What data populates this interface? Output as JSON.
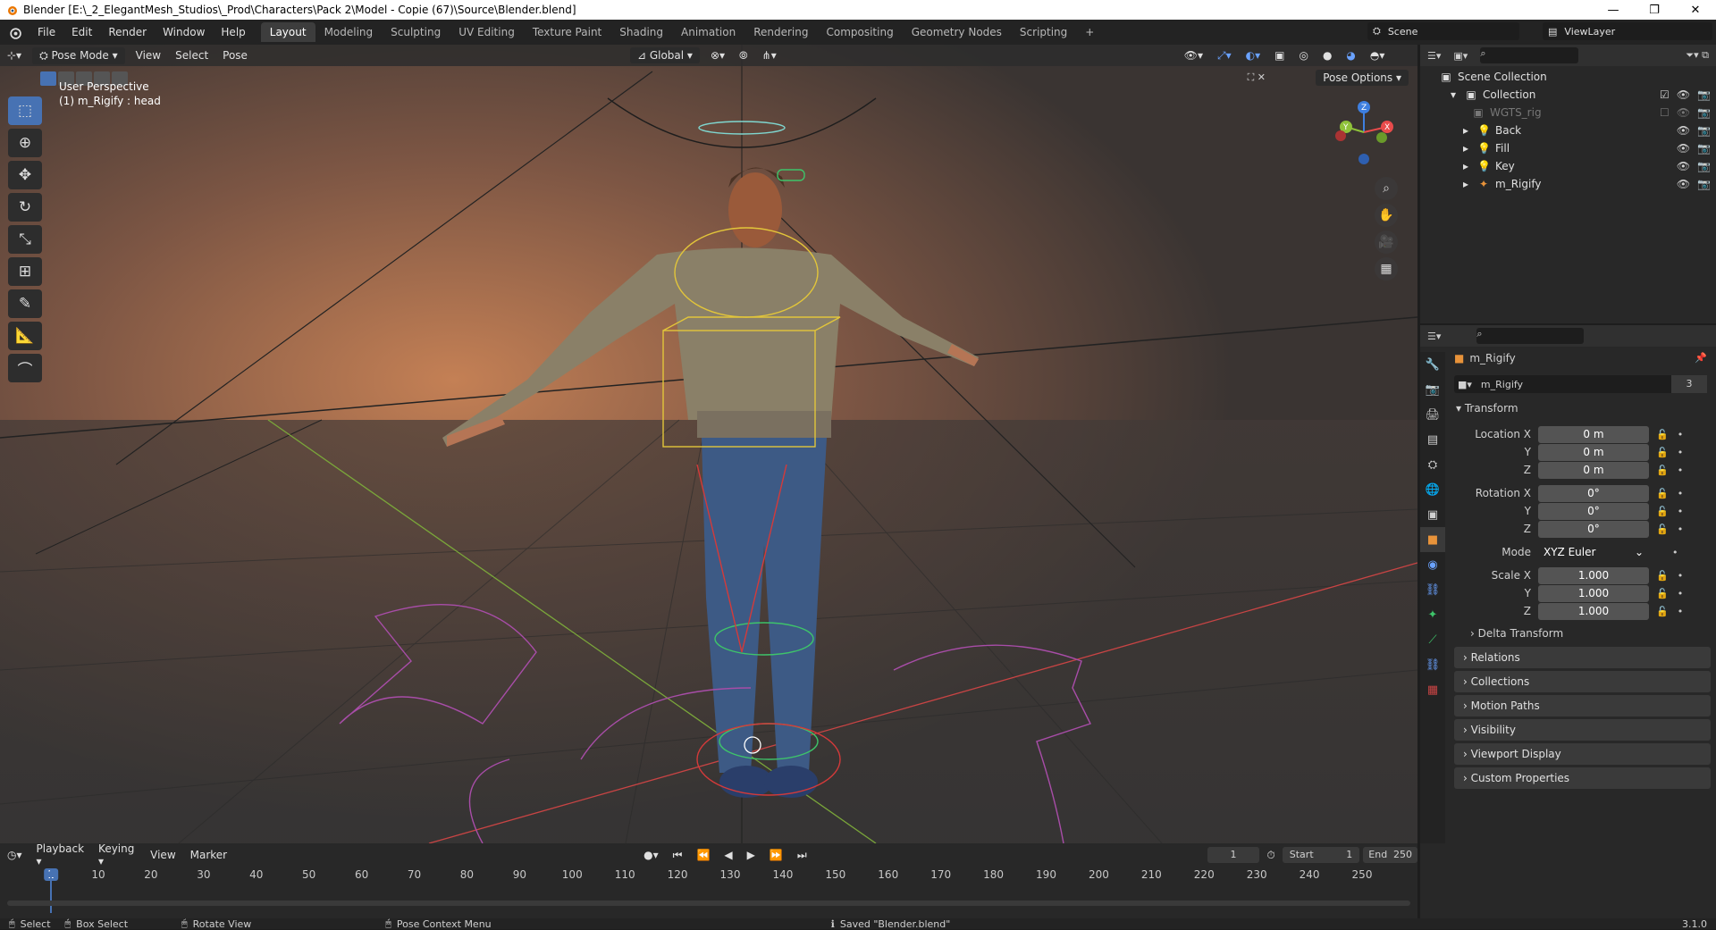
{
  "title": "Blender [E:\\_2_ElegantMesh_Studios\\_Prod\\Characters\\Pack 2\\Model - Copie (67)\\Source\\Blender.blend]",
  "menu": [
    "File",
    "Edit",
    "Render",
    "Window",
    "Help"
  ],
  "workspace_tabs": [
    "Layout",
    "Modeling",
    "Sculpting",
    "UV Editing",
    "Texture Paint",
    "Shading",
    "Animation",
    "Rendering",
    "Compositing",
    "Geometry Nodes",
    "Scripting"
  ],
  "scene": "Scene",
  "view_layer": "ViewLayer",
  "viewport": {
    "mode": "Pose Mode",
    "menus": [
      "View",
      "Select",
      "Pose"
    ],
    "transform_orientation": "Global",
    "pose_options": "Pose Options",
    "perspective": "User Perspective",
    "active": "(1) m_Rigify : head"
  },
  "outliner": {
    "root": "Scene Collection",
    "items": [
      "Collection",
      "WGTS_rig",
      "Back",
      "Fill",
      "Key",
      "m_Rigify"
    ]
  },
  "properties": {
    "object_name": "m_Rigify",
    "datablock": "m_Rigify",
    "users": "3",
    "transform_label": "Transform",
    "location": {
      "label": "Location X",
      "x": "0 m",
      "y": "0 m",
      "z": "0 m"
    },
    "rotation": {
      "label": "Rotation X",
      "x": "0°",
      "y": "0°",
      "z": "0°"
    },
    "mode_label": "Mode",
    "mode": "XYZ Euler",
    "scale": {
      "label": "Scale X",
      "x": "1.000",
      "y": "1.000",
      "z": "1.000"
    },
    "axis_y": "Y",
    "axis_z": "Z",
    "delta": "Delta Transform",
    "panels": [
      "Relations",
      "Collections",
      "Motion Paths",
      "Visibility",
      "Viewport Display",
      "Custom Properties"
    ]
  },
  "timeline": {
    "menus": [
      "Playback",
      "Keying",
      "View",
      "Marker"
    ],
    "current_frame": "1",
    "start_label": "Start",
    "start": "1",
    "end_label": "End",
    "end": "250",
    "ticks": [
      "1",
      "10",
      "20",
      "30",
      "40",
      "50",
      "60",
      "70",
      "80",
      "90",
      "100",
      "110",
      "120",
      "130",
      "140",
      "150",
      "160",
      "170",
      "180",
      "190",
      "200",
      "210",
      "220",
      "230",
      "240",
      "250"
    ]
  },
  "status": {
    "select": "Select",
    "box_select": "Box Select",
    "rotate_view": "Rotate View",
    "context_menu": "Pose Context Menu",
    "message": "Saved \"Blender.blend\"",
    "version": "3.1.0"
  },
  "colors": {
    "accent": "#4772b3",
    "x_axis": "#e84b4b",
    "y_axis": "#8fc23a",
    "z_axis": "#3e7fe0"
  }
}
